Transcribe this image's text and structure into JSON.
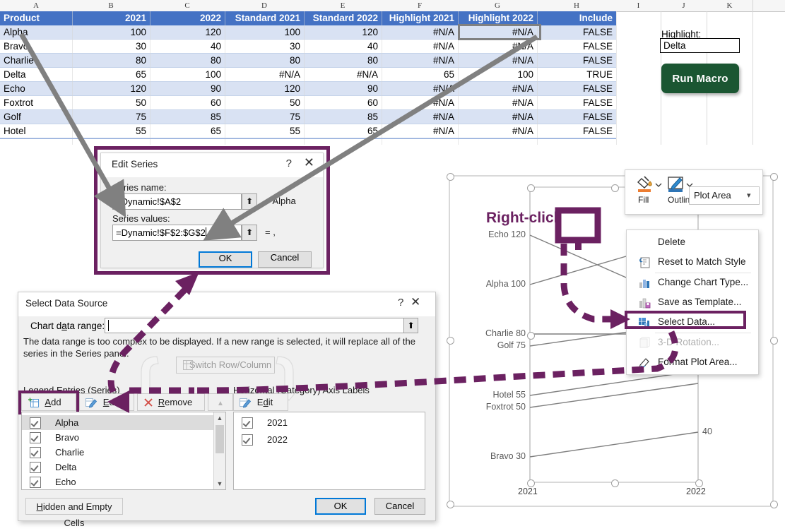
{
  "spreadsheet": {
    "column_letters": [
      "A",
      "B",
      "C",
      "D",
      "E",
      "F",
      "G",
      "H",
      "I",
      "J",
      "K"
    ],
    "headers": [
      "Product",
      "2021",
      "2022",
      "Standard 2021",
      "Standard 2022",
      "Highlight 2021",
      "Highlight 2022",
      "Include"
    ],
    "rows": [
      {
        "product": "Alpha",
        "v2021": "100",
        "v2022": "120",
        "s2021": "100",
        "s2022": "120",
        "h2021": "#N/A",
        "h2022": "#N/A",
        "include": "FALSE"
      },
      {
        "product": "Bravo",
        "v2021": "30",
        "v2022": "40",
        "s2021": "30",
        "s2022": "40",
        "h2021": "#N/A",
        "h2022": "#N/A",
        "include": "FALSE"
      },
      {
        "product": "Charlie",
        "v2021": "80",
        "v2022": "80",
        "s2021": "80",
        "s2022": "80",
        "h2021": "#N/A",
        "h2022": "#N/A",
        "include": "FALSE"
      },
      {
        "product": "Delta",
        "v2021": "65",
        "v2022": "100",
        "s2021": "#N/A",
        "s2022": "#N/A",
        "h2021": "65",
        "h2022": "100",
        "include": "TRUE"
      },
      {
        "product": "Echo",
        "v2021": "120",
        "v2022": "90",
        "s2021": "120",
        "s2022": "90",
        "h2021": "#N/A",
        "h2022": "#N/A",
        "include": "FALSE"
      },
      {
        "product": "Foxtrot",
        "v2021": "50",
        "v2022": "60",
        "s2021": "50",
        "s2022": "60",
        "h2021": "#N/A",
        "h2022": "#N/A",
        "include": "FALSE"
      },
      {
        "product": "Golf",
        "v2021": "75",
        "v2022": "85",
        "s2021": "75",
        "s2022": "85",
        "h2021": "#N/A",
        "h2022": "#N/A",
        "include": "FALSE"
      },
      {
        "product": "Hotel",
        "v2021": "55",
        "v2022": "65",
        "s2021": "55",
        "s2022": "65",
        "h2021": "#N/A",
        "h2022": "#N/A",
        "include": "FALSE"
      }
    ],
    "controls": {
      "highlight_label": "Highlight:",
      "highlight_value": "Delta",
      "run_macro_label": "Run Macro"
    }
  },
  "edit_series_dialog": {
    "title": "Edit Series",
    "help": "?",
    "close": "✕",
    "series_name_label": "Series name:",
    "series_name_value": "=Dynamic!$A$2",
    "series_name_result": "= Alpha",
    "series_values_label": "Series values:",
    "series_values_value": "=Dynamic!$F$2:$G$2",
    "series_values_result": "= ,",
    "range_btn_icon": "range-picker-icon",
    "ok": "OK",
    "cancel": "Cancel"
  },
  "select_data_dialog": {
    "title": "Select Data Source",
    "help": "?",
    "close": "✕",
    "chart_data_range_label": "Chart data range:",
    "chart_data_range_value": "",
    "note": "The data range is too complex to be displayed. If a new range is selected, it will replace all of the series in the Series panel.",
    "switch_row_column": "Switch Row/Column",
    "legend_header": "Legend Entries (Series)",
    "category_header": "Horizontal (Category) Axis Labels",
    "legend_buttons": [
      "Add",
      "Edit",
      "Remove"
    ],
    "category_buttons": [
      "Edit"
    ],
    "series_items": [
      "Alpha",
      "Bravo",
      "Charlie",
      "Delta",
      "Echo"
    ],
    "category_items": [
      "2021",
      "2022"
    ],
    "hidden_empty_cells": "Hidden and Empty Cells",
    "ok": "OK",
    "cancel": "Cancel"
  },
  "mini_toolbar": {
    "fill_label": "Fill",
    "outline_label": "Outline",
    "element_selector_value": "Plot Area"
  },
  "context_menu": {
    "items": [
      {
        "label": "Delete",
        "icon": "none",
        "disabled": false,
        "highlighted": false
      },
      {
        "label": "Reset to Match Style",
        "icon": "reset-style-icon",
        "disabled": false,
        "highlighted": false
      },
      {
        "label": "Change Chart Type...",
        "icon": "chart-type-icon",
        "disabled": false,
        "highlighted": false
      },
      {
        "label": "Save as Template...",
        "icon": "save-template-icon",
        "disabled": false,
        "highlighted": false
      },
      {
        "label": "Select Data...",
        "icon": "select-data-icon",
        "disabled": false,
        "highlighted": true
      },
      {
        "label": "3-D Rotation...",
        "icon": "rotation-icon",
        "disabled": true,
        "highlighted": false
      },
      {
        "label": "Format Plot Area...",
        "icon": "format-area-icon",
        "disabled": false,
        "highlighted": false
      }
    ]
  },
  "annotations": {
    "right_click_text": "Right-click"
  },
  "chart_data": {
    "type": "line",
    "title": "",
    "categories": [
      "2021",
      "2022"
    ],
    "series": [
      {
        "name": "Echo",
        "values": [
          120,
          90
        ],
        "left_label": "Echo 120",
        "right_label": ""
      },
      {
        "name": "Alpha",
        "values": [
          100,
          120
        ],
        "left_label": "Alpha 100",
        "right_label": ""
      },
      {
        "name": "Charlie",
        "values": [
          80,
          80
        ],
        "left_label": "Charlie 80",
        "right_label": ""
      },
      {
        "name": "Golf",
        "values": [
          75,
          85
        ],
        "left_label": "Golf 75",
        "right_label": ""
      },
      {
        "name": "Hotel",
        "values": [
          55,
          65
        ],
        "left_label": "Hotel 55",
        "right_label": ""
      },
      {
        "name": "Foxtrot",
        "values": [
          50,
          60
        ],
        "left_label": "Foxtrot 50",
        "right_label": ""
      },
      {
        "name": "Bravo",
        "values": [
          30,
          40
        ],
        "left_label": "Bravo 30",
        "right_label": "40"
      }
    ],
    "xlabel": "",
    "ylabel": "",
    "ylim": [
      20,
      130
    ],
    "grid": false,
    "legend": "none",
    "visible_right_labels": [
      "40"
    ],
    "axis_tick_labels": [
      "2021",
      "2022"
    ]
  }
}
